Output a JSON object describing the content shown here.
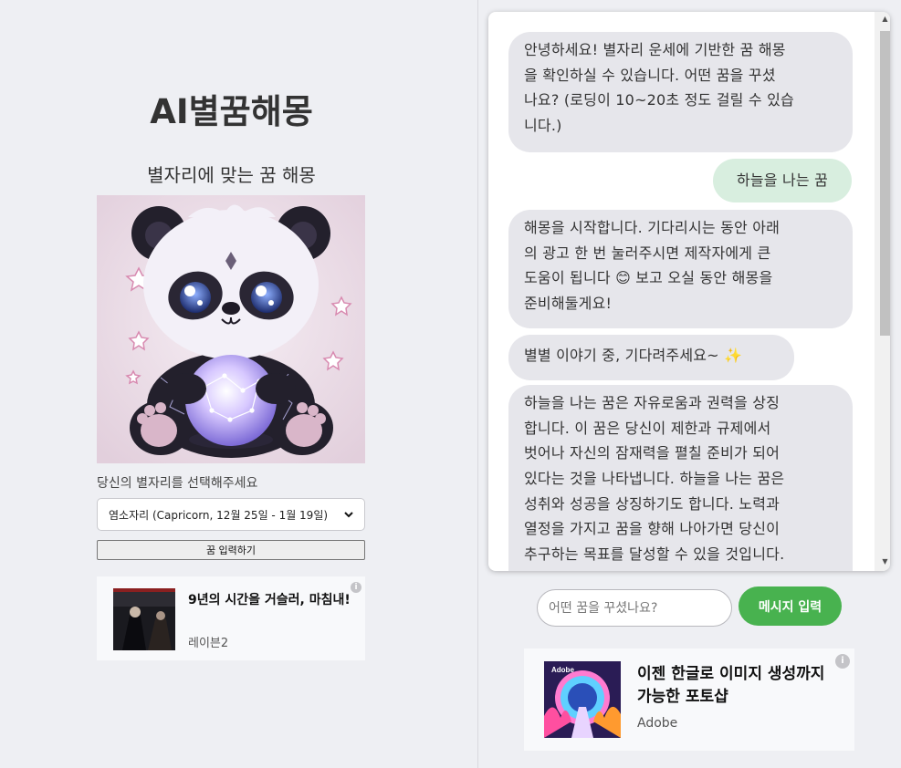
{
  "header": {
    "title": "AI별꿈해몽",
    "subtitle": "별자리에 맞는 꿈 해몽"
  },
  "hero": {
    "icon": "panda-with-crystal-ball"
  },
  "zodiac": {
    "label": "당신의 별자리를 선택해주세요",
    "selected": "염소자리 (Capricorn, 12월 25일 - 1월 19일)"
  },
  "dream_button": {
    "label": "꿈 입력하기"
  },
  "ad_left": {
    "title": "9년의 시간을 거슬러, 마침내!",
    "source": "레이븐2",
    "info": "i"
  },
  "chat": {
    "messages": [
      {
        "role": "bot",
        "lines": [
          "안녕하세요! 별자리 운세에 기반한 꿈 해몽",
          "을 확인하실 수 있습니다. 어떤 꿈을 꾸셨",
          "나요? (로딩이 10~20초 정도 걸릴 수 있습",
          "니다.)"
        ]
      },
      {
        "role": "user",
        "lines": [
          "하늘을 나는 꿈"
        ]
      },
      {
        "role": "bot",
        "lines": [
          "해몽을 시작합니다. 기다리시는 동안 아래",
          "의 광고 한 번 눌러주시면 제작자에게 큰",
          "도움이 됩니다 😊 보고 오실 동안 해몽을",
          "준비해둘게요!"
        ]
      },
      {
        "role": "bot",
        "lines": [
          "별별 이야기 중, 기다려주세요~ ✨"
        ]
      },
      {
        "role": "bot",
        "lines": [
          "하늘을 나는 꿈은 자유로움과 권력을 상징",
          "합니다. 이 꿈은 당신이 제한과 규제에서",
          "벗어나 자신의 잠재력을 펼칠 준비가 되어",
          "있다는 것을 나타냅니다. 하늘을 나는 꿈은",
          "성취와 성공을 상징하기도 합니다. 노력과",
          "열정을 가지고 꿈을 향해 나아가면 당신이",
          "추구하는 목표를 달성할 수 있을 것입니다."
        ]
      }
    ]
  },
  "input": {
    "placeholder": "어떤 꿈을 꾸셨나요?"
  },
  "send_button": {
    "label": "메시지 입력"
  },
  "ad_right": {
    "title": "이젠 한글로 이미지 생성까지 가능한 포토샵",
    "source": "Adobe",
    "thumb_logo": "Adobe",
    "info": "i"
  },
  "colors": {
    "page_bg": "#eeeff3",
    "bot_bubble": "#e6e6eb",
    "user_bubble": "#d8eedf",
    "send_button": "#48b24f"
  }
}
